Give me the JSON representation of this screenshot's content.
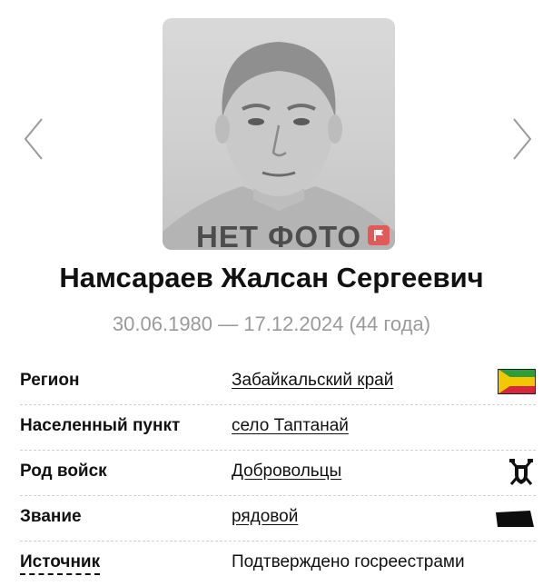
{
  "photo": {
    "placeholder_text": "НЕТ ФОТО"
  },
  "person": {
    "name": "Намсараев Жалсан Сергеевич",
    "dates": "30.06.1980 — 17.12.2024 (44 года)"
  },
  "details": [
    {
      "label": "Регион",
      "value": "Забайкальский край",
      "icon": "zabaykalsky-flag-icon"
    },
    {
      "label": "Населенный пункт",
      "value": "село Таптанай"
    },
    {
      "label": "Род войск",
      "value": "Добровольцы",
      "icon": "volunteers-emblem-icon"
    },
    {
      "label": "Звание",
      "value": "рядовой",
      "icon": "rank-insignia-icon"
    },
    {
      "label": "Источник",
      "value": "Подтверждено госреестрами"
    }
  ],
  "colors": {
    "flag_yellow": "#f2c800",
    "flag_green": "#2f9d3a",
    "flag_red": "#d7263d",
    "report_button": "#e05a57",
    "dates_gray": "#9a9a9a"
  }
}
